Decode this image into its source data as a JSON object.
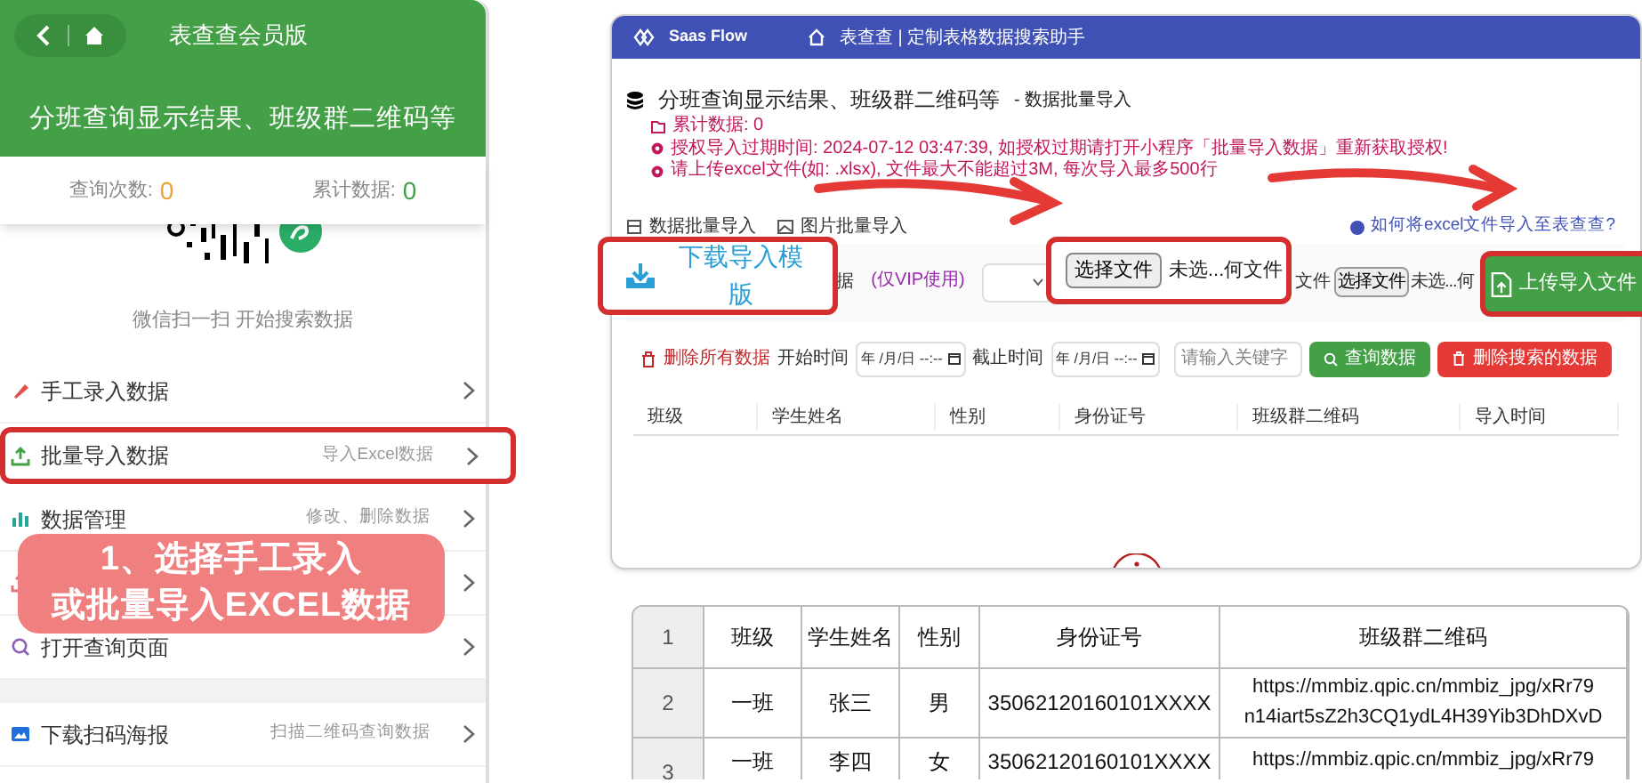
{
  "phone": {
    "nav_title": "表查查会员版",
    "banner": "分班查询显示结果、班级群二维码等",
    "stats": [
      {
        "label": "查询次数:",
        "value": "0",
        "color": "#f0a030"
      },
      {
        "label": "累计数据:",
        "value": "0",
        "color": "#43a047"
      }
    ],
    "qr_caption": "微信扫一扫 开始搜索数据",
    "menu": [
      {
        "label": "手工录入数据",
        "highlighted": false
      },
      {
        "label": "批量导入数据",
        "hint": "导入Excel数据",
        "highlighted": true
      },
      {
        "label": "数据管理",
        "hint": "修改、删除数据",
        "highlighted": false
      },
      {
        "highlighted": false
      },
      {
        "label": "打开查询页面",
        "highlighted": false
      }
    ],
    "menu_2": [
      {
        "label": "下载扫码海报",
        "hint": "扫描二维码查询数据"
      }
    ]
  },
  "caption": [
    "1、选择手工录入",
    "或批量导入EXCEL数据"
  ],
  "web": {
    "brand": "Saas Flow",
    "breadcrumb": "表查查 | 定制表格数据搜索助手",
    "title": "分班查询显示结果、班级群二维码等",
    "title_suffix": "- 数据批量导入",
    "notes": [
      "累计数据: 0",
      "授权导入过期时间: 2024-07-12 03:47:39, 如授权过期请打开小程序「批量导入数据」重新获取授权!",
      "请上传excel文件(如: .xlsx), 文件最大不能超过3M, 每次导入最多500行"
    ],
    "tabs": [
      "数据批量导入",
      "图片批量导入"
    ],
    "help_link": "如何将excel文件导入至表查查?",
    "label_fragment": "据",
    "vip_note": "(仅VIP使用)",
    "file_label": "文件",
    "small_picker": {
      "button": "选择文件",
      "value": "未选...何"
    },
    "filters": {
      "delete_all": "删除所有数据",
      "start_label": "开始时间",
      "start_value": "年 /月/日 --:--",
      "end_label": "截止时间",
      "end_value": "年 /月/日 --:--",
      "search_placeholder": "请输入关键字",
      "query": "查询数据",
      "delete_found": "删除搜索的数据"
    },
    "columns": [
      "班级",
      "学生姓名",
      "性别",
      "身份证号",
      "班级群二维码",
      "导入时间"
    ]
  },
  "callouts": {
    "download": "下载导入模版",
    "picker": {
      "button": "选择文件",
      "value": "未选...何文件"
    },
    "upload": "上传导入文件"
  },
  "sheet": {
    "rows": [
      {
        "number": "1",
        "cells": [
          "班级",
          "学生姓名",
          "性别",
          "身份证号",
          "班级群二维码"
        ]
      },
      {
        "number": "2",
        "cells": [
          "一班",
          "张三",
          "男",
          "35062120160101XXXX",
          "https://mmbiz.qpic.cn/mmbiz_jpg/xRr79 n14iart5sZ2h3CQ1ydL4H39Yib3DhDXvD"
        ]
      },
      {
        "number": "3",
        "cells": [
          "一班",
          "李四",
          "女",
          "35062120160101XXXX",
          "https://mmbiz.qpic.cn/mmbiz_jpg/xRr79"
        ]
      }
    ]
  }
}
